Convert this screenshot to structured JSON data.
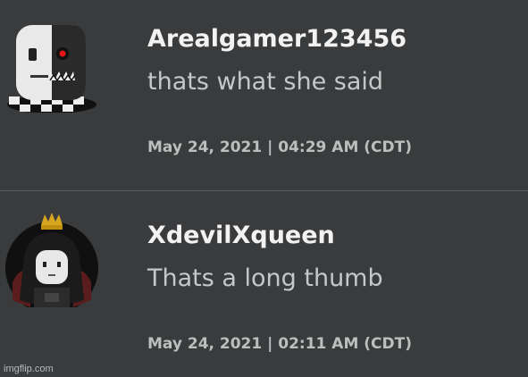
{
  "comments": [
    {
      "username": "Arealgamer123456",
      "text": "thats what she said",
      "timestamp": "May 24, 2021 | 04:29 AM (CDT)",
      "avatar_icon": "white-mask-avatar-icon"
    },
    {
      "username": "XdevilXqueen",
      "text": "Thats a long thumb",
      "timestamp": "May 24, 2021 | 02:11 AM (CDT)",
      "avatar_icon": "crowned-queen-avatar-icon"
    }
  ],
  "watermark": "imgflip.com",
  "colors": {
    "background": "#393b3d",
    "username": "#f2f2f2",
    "text": "#c6c7c8",
    "meta": "#bdbebe",
    "divider": "#5a5c5e"
  }
}
